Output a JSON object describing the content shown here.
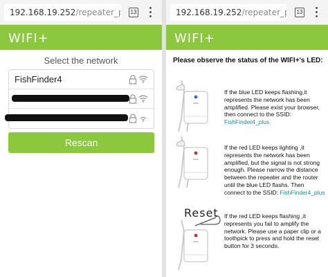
{
  "left": {
    "browser": {
      "url_host": "192.168.19.252",
      "url_path": "/repeater_phone_s",
      "tab_count": "13"
    },
    "logo": "WIFI+",
    "select_title": "Select the network",
    "networks": [
      {
        "name": "FishFinder4",
        "redacted": false,
        "locked": true
      },
      {
        "name": "",
        "redacted": true,
        "locked": true
      },
      {
        "name": "",
        "redacted": true,
        "locked": true
      }
    ],
    "rescan_label": "Rescan"
  },
  "right": {
    "browser": {
      "url_host": "192.168.19.252",
      "url_path": "/repeater_phone_s",
      "tab_count": "13"
    },
    "logo": "WIFI+",
    "title": "Please observe the status of the WIFI+'s LED:",
    "steps": [
      {
        "led_color": "#2a6fd6",
        "text": "If the blue LED keeps flashing,it represents the network has been amplified. Please exist your browser, then connect to the SSID: ",
        "ssid": "FishFinder4_plus"
      },
      {
        "led_color": "#d62a2a",
        "text": "If the red LED keeps lighting ,it represents the network has been amplified, but the signal is not strong enough. Please narrow the distance between the repeater and the router until the blue LED flashs. Then connect to the SSID: ",
        "ssid": "FishFinder4_plus"
      },
      {
        "led_color": "#d62a2a",
        "text": "If the red LED keeps flashing ,it represents you fail to amplify the network. Please use a paper clip or a toothpick to press and hold the reset button for 3 seconds.",
        "ssid": "",
        "image_label": "Reset"
      }
    ]
  },
  "colors": {
    "brand_green": "#8cc83e",
    "link_teal": "#1c8a8a"
  },
  "icons": [
    "lock-icon",
    "wifi-icon",
    "tab-switcher-icon",
    "overflow-menu-icon"
  ]
}
